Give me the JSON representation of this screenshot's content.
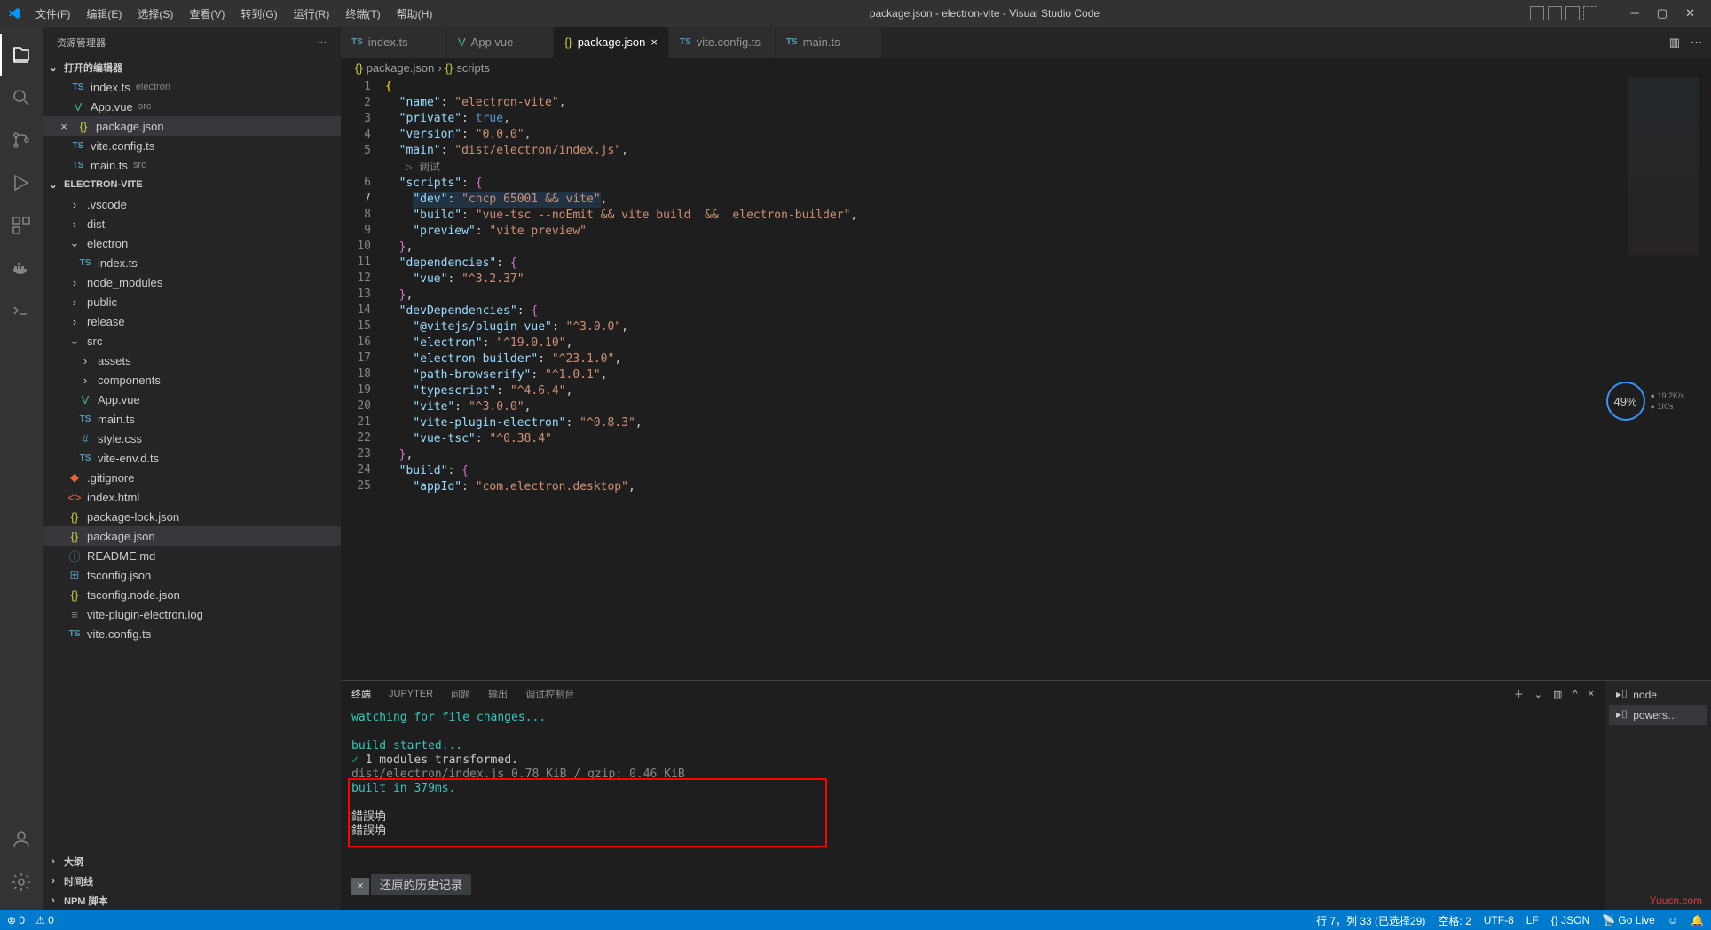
{
  "window": {
    "title": "package.json - electron-vite - Visual Studio Code"
  },
  "menu": {
    "file": "文件(F)",
    "edit": "编辑(E)",
    "selection": "选择(S)",
    "view": "查看(V)",
    "go": "转到(G)",
    "run": "运行(R)",
    "terminal": "终端(T)",
    "help": "帮助(H)"
  },
  "sidebar": {
    "title": "资源管理器",
    "openEditors": {
      "label": "打开的编辑器",
      "items": [
        {
          "icon": "TS",
          "name": "index.ts",
          "suffix": "electron"
        },
        {
          "icon": "V",
          "name": "App.vue",
          "suffix": "src"
        },
        {
          "icon": "{}",
          "name": "package.json",
          "active": true,
          "close": true
        },
        {
          "icon": "TS",
          "name": "vite.config.ts"
        },
        {
          "icon": "TS",
          "name": "main.ts",
          "suffix": "src"
        }
      ]
    },
    "project": {
      "label": "ELECTRON-VITE",
      "tree": [
        {
          "indent": 1,
          "chev": ">",
          "name": ".vscode",
          "type": "folder"
        },
        {
          "indent": 1,
          "chev": ">",
          "name": "dist",
          "type": "folder"
        },
        {
          "indent": 1,
          "chev": "v",
          "name": "electron",
          "type": "folder"
        },
        {
          "indent": 2,
          "icon": "TS",
          "name": "index.ts",
          "type": "ts"
        },
        {
          "indent": 1,
          "chev": ">",
          "name": "node_modules",
          "type": "folder"
        },
        {
          "indent": 1,
          "chev": ">",
          "name": "public",
          "type": "folder"
        },
        {
          "indent": 1,
          "chev": ">",
          "name": "release",
          "type": "folder"
        },
        {
          "indent": 1,
          "chev": "v",
          "name": "src",
          "type": "folder"
        },
        {
          "indent": 2,
          "chev": ">",
          "name": "assets",
          "type": "folder"
        },
        {
          "indent": 2,
          "chev": ">",
          "name": "components",
          "type": "folder"
        },
        {
          "indent": 2,
          "icon": "V",
          "name": "App.vue",
          "type": "vue"
        },
        {
          "indent": 2,
          "icon": "TS",
          "name": "main.ts",
          "type": "ts"
        },
        {
          "indent": 2,
          "icon": "#",
          "name": "style.css",
          "type": "css"
        },
        {
          "indent": 2,
          "icon": "TS",
          "name": "vite-env.d.ts",
          "type": "ts"
        },
        {
          "indent": 1,
          "icon": "◆",
          "name": ".gitignore",
          "type": "git"
        },
        {
          "indent": 1,
          "icon": "<>",
          "name": "index.html",
          "type": "html"
        },
        {
          "indent": 1,
          "icon": "{}",
          "name": "package-lock.json",
          "type": "json"
        },
        {
          "indent": 1,
          "icon": "{}",
          "name": "package.json",
          "type": "json",
          "active": true
        },
        {
          "indent": 1,
          "icon": "ⓘ",
          "name": "README.md",
          "type": "md"
        },
        {
          "indent": 1,
          "icon": "⊞",
          "name": "tsconfig.json",
          "type": "json2"
        },
        {
          "indent": 1,
          "icon": "{}",
          "name": "tsconfig.node.json",
          "type": "json"
        },
        {
          "indent": 1,
          "icon": "≡",
          "name": "vite-plugin-electron.log",
          "type": "log"
        },
        {
          "indent": 1,
          "icon": "TS",
          "name": "vite.config.ts",
          "type": "ts"
        }
      ]
    },
    "outline": "大纲",
    "timeline": "时间线",
    "npm": "NPM 脚本"
  },
  "tabs": [
    {
      "icon": "TS",
      "label": "index.ts"
    },
    {
      "icon": "V",
      "label": "App.vue"
    },
    {
      "icon": "{}",
      "label": "package.json",
      "active": true,
      "close": true
    },
    {
      "icon": "TS",
      "label": "vite.config.ts"
    },
    {
      "icon": "TS",
      "label": "main.ts"
    }
  ],
  "breadcrumb": {
    "icon1": "{}",
    "part1": "package.json",
    "icon2": "{}",
    "part2": "scripts"
  },
  "code": {
    "debugHint": "▷ 调试",
    "lines": [
      "1",
      "2",
      "3",
      "4",
      "5",
      "6",
      "7",
      "8",
      "9",
      "10",
      "11",
      "12",
      "13",
      "14",
      "15",
      "16",
      "17",
      "18",
      "19",
      "20",
      "21",
      "22",
      "23",
      "24",
      "25"
    ]
  },
  "json_content": {
    "name": "electron-vite",
    "private": "true",
    "version": "0.0.0",
    "main": "dist/electron/index.js",
    "scripts": {
      "dev": "chcp 65001 && vite",
      "build": "vue-tsc --noEmit && vite build  &&  electron-builder",
      "preview": "vite preview"
    },
    "dependencies": {
      "vue": "^3.2.37"
    },
    "devDependencies": {
      "@vitejs/plugin-vue": "^3.0.0",
      "electron": "^19.0.10",
      "electron-builder": "^23.1.0",
      "path-browserify": "^1.0.1",
      "typescript": "^4.6.4",
      "vite": "^3.0.0",
      "vite-plugin-electron": "^0.8.3",
      "vue-tsc": "^0.38.4"
    },
    "build": {
      "appId": "com.electron.desktop"
    }
  },
  "panel": {
    "tabs": {
      "terminal": "终端",
      "jupyter": "JUPYTER",
      "problems": "问题",
      "output": "输出",
      "debug": "调试控制台"
    },
    "terminal": {
      "l1": "watching for file changes...",
      "l2": "build started...",
      "l3a": "✓",
      "l3b": " 1 modules transformed.",
      "l4a": "dist/electron/index.js",
      "l4b": "   0.78 KiB / gzip: 0.46 KiB",
      "l5": "built in 379ms.",
      "l6": "錯誤埆",
      "l7": "錯誤埆",
      "history": "还原的历史记录",
      "historyX": "×"
    },
    "side": {
      "node": "node",
      "powershell": "powers…"
    }
  },
  "statusbar": {
    "errors": "0",
    "warnings": "0",
    "pos": "行 7，列 33 (已选择29)",
    "spaces": "空格: 2",
    "encoding": "UTF-8",
    "eol": "LF",
    "lang": "JSON",
    "golive": "Go Live"
  },
  "cpu": {
    "percent": "49%",
    "up": "● 19.2K/s",
    "down": "● 1K/s"
  },
  "watermark": "Yuucn.com"
}
